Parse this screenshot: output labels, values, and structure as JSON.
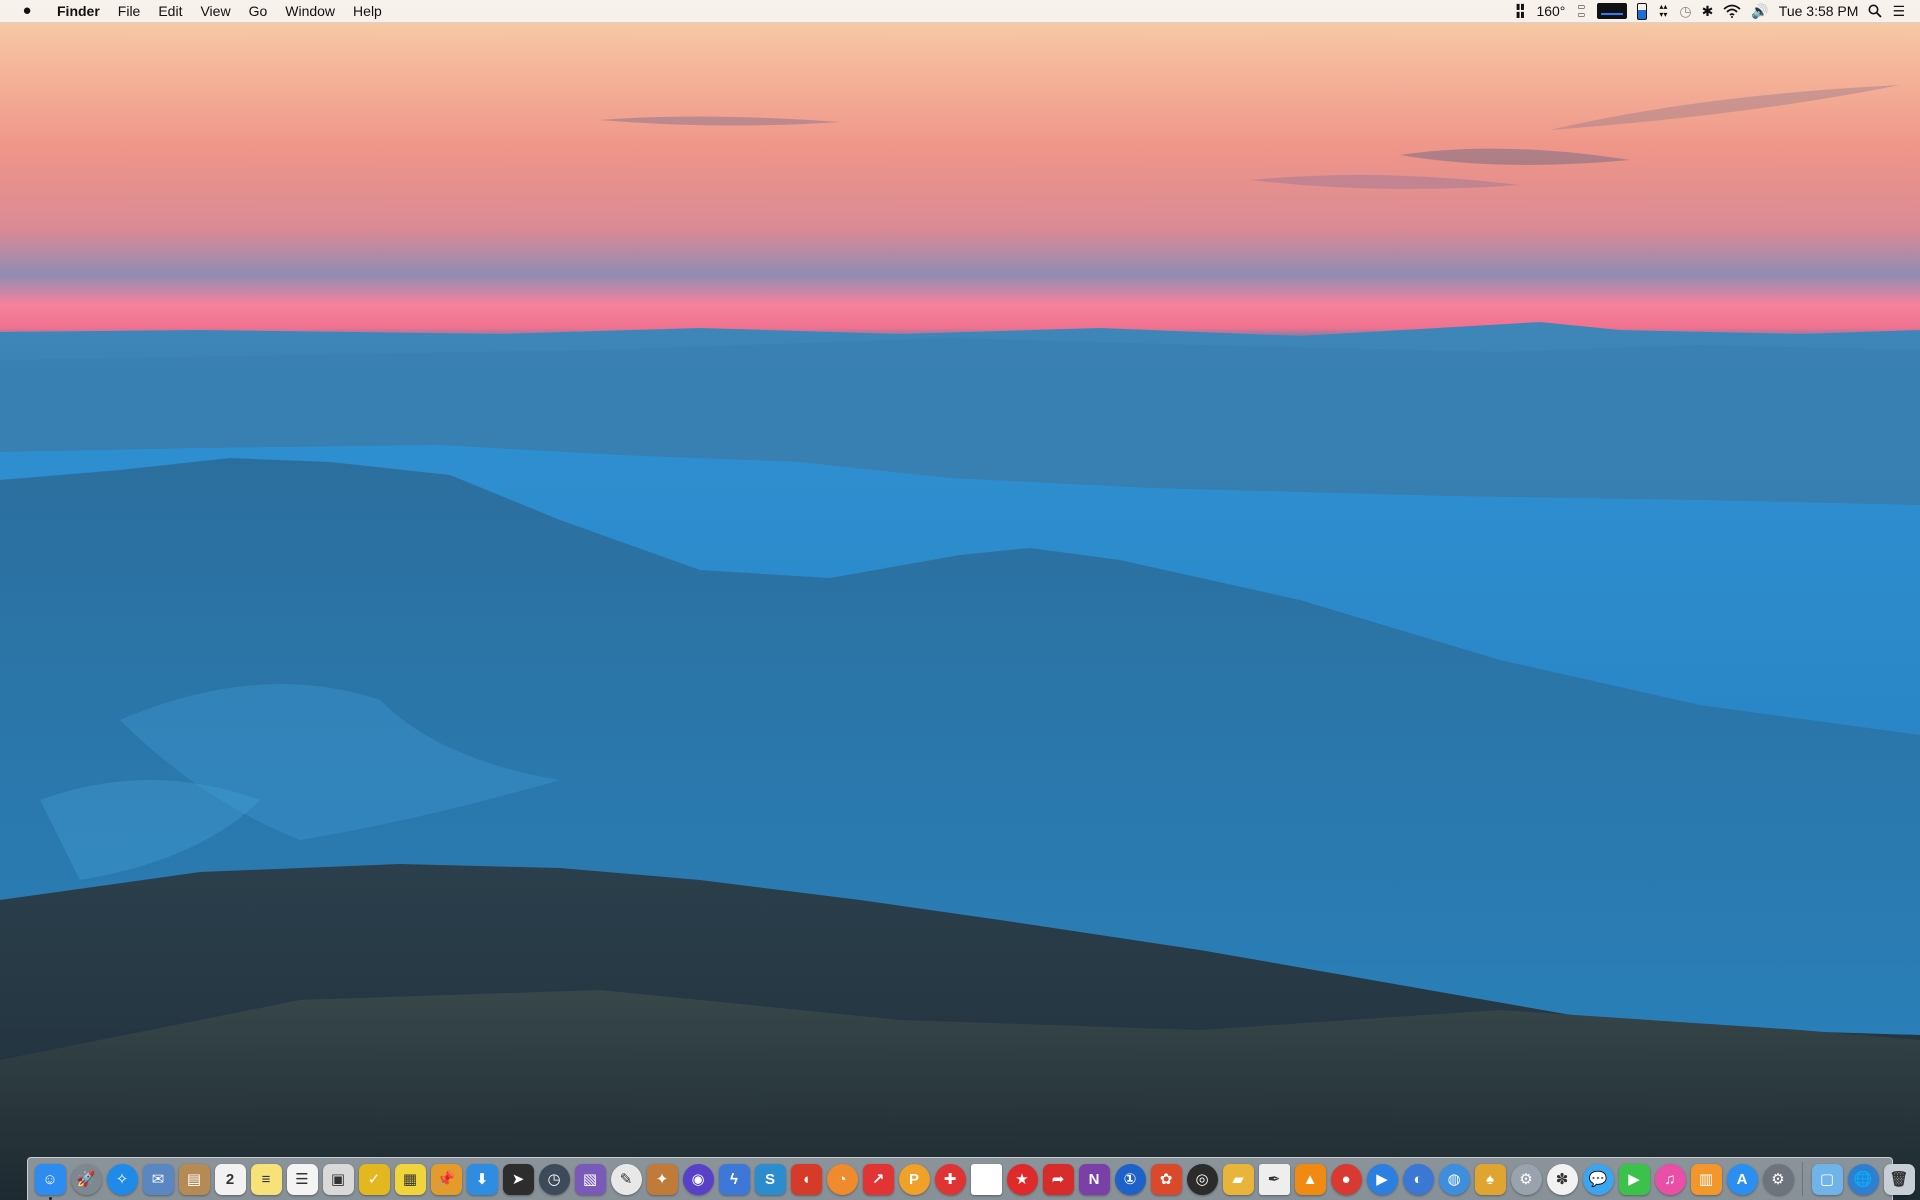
{
  "menubar": {
    "app_name": "Finder",
    "menus": [
      "File",
      "Edit",
      "View",
      "Go",
      "Window",
      "Help"
    ],
    "status": {
      "temperature": "160°",
      "clock": "Tue 3:58 PM"
    }
  },
  "dock": {
    "apps": [
      {
        "name": "finder-icon",
        "glyph": "☺",
        "color": "#2d8cf0",
        "shape": "",
        "running": true
      },
      {
        "name": "launchpad-icon",
        "glyph": "🚀",
        "color": "#7f8791",
        "shape": "round",
        "running": false
      },
      {
        "name": "safari-icon",
        "glyph": "✧",
        "color": "#1f8ae8",
        "shape": "round",
        "running": false
      },
      {
        "name": "mail-icon",
        "glyph": "✉",
        "color": "#5a86c2",
        "shape": "",
        "running": false
      },
      {
        "name": "contacts-icon",
        "glyph": "▤",
        "color": "#b58a55",
        "shape": "",
        "running": false
      },
      {
        "name": "calendar-icon",
        "glyph": "2",
        "color": "#f2f2f2",
        "shape": "",
        "running": false
      },
      {
        "name": "notes-icon",
        "glyph": "≡",
        "color": "#f7e27a",
        "shape": "",
        "running": false
      },
      {
        "name": "reminders-icon",
        "glyph": "☰",
        "color": "#f4f4f4",
        "shape": "",
        "running": false
      },
      {
        "name": "preview-icon",
        "glyph": "▣",
        "color": "#d9d9d9",
        "shape": "",
        "running": false
      },
      {
        "name": "omnifocus-icon",
        "glyph": "✓",
        "color": "#e2b720",
        "shape": "",
        "running": false
      },
      {
        "name": "stickies-icon",
        "glyph": "▦",
        "color": "#f1d43c",
        "shape": "",
        "running": false
      },
      {
        "name": "pin-icon",
        "glyph": "📌",
        "color": "#e39b2c",
        "shape": "",
        "running": false
      },
      {
        "name": "downloads-icon",
        "glyph": "⬇",
        "color": "#2e8de0",
        "shape": "",
        "running": false
      },
      {
        "name": "cursor-icon",
        "glyph": "➤",
        "color": "#2d2d2d",
        "shape": "",
        "running": false
      },
      {
        "name": "time-machine-icon",
        "glyph": "◷",
        "color": "#3c4a5a",
        "shape": "round",
        "running": false
      },
      {
        "name": "photo-browser-icon",
        "glyph": "▧",
        "color": "#7a5ab8",
        "shape": "",
        "running": false
      },
      {
        "name": "script-editor-icon",
        "glyph": "✎",
        "color": "#e8e8e8",
        "shape": "round",
        "running": false
      },
      {
        "name": "stocks-icon",
        "glyph": "✦",
        "color": "#c07a3a",
        "shape": "",
        "running": false
      },
      {
        "name": "globe-purple-icon",
        "glyph": "◉",
        "color": "#5840c9",
        "shape": "round",
        "running": false
      },
      {
        "name": "lightning-icon",
        "glyph": "ϟ",
        "color": "#3d78d8",
        "shape": "",
        "running": false
      },
      {
        "name": "scrivener-icon",
        "glyph": "S",
        "color": "#2d8ccd",
        "shape": "",
        "running": false
      },
      {
        "name": "airship-icon",
        "glyph": "◖",
        "color": "#d63b2a",
        "shape": "",
        "running": false
      },
      {
        "name": "istat-icon",
        "glyph": "◔",
        "color": "#f08a2d",
        "shape": "round",
        "running": false
      },
      {
        "name": "pushpin-red-icon",
        "glyph": "↗",
        "color": "#e23434",
        "shape": "",
        "running": false
      },
      {
        "name": "pdf-pen-icon",
        "glyph": "P",
        "color": "#f0a12a",
        "shape": "round",
        "running": false
      },
      {
        "name": "lifesaver-icon",
        "glyph": "✚",
        "color": "#e03333",
        "shape": "round",
        "running": false
      },
      {
        "name": "blank-document-icon",
        "glyph": "",
        "color": "#ffffff",
        "shape": "doc",
        "running": false
      },
      {
        "name": "red-star-icon",
        "glyph": "★",
        "color": "#e02a2a",
        "shape": "round",
        "running": false
      },
      {
        "name": "flag-icon",
        "glyph": "➦",
        "color": "#d82c2c",
        "shape": "",
        "running": false
      },
      {
        "name": "onenote-icon",
        "glyph": "N",
        "color": "#7b3fa8",
        "shape": "",
        "running": false
      },
      {
        "name": "1password-icon",
        "glyph": "①",
        "color": "#1d62c9",
        "shape": "round",
        "running": false
      },
      {
        "name": "pinwheel-icon",
        "glyph": "✿",
        "color": "#d9492a",
        "shape": "",
        "running": false
      },
      {
        "name": "dvd-player-icon",
        "glyph": "◎",
        "color": "#2b2b2b",
        "shape": "round",
        "running": false
      },
      {
        "name": "folder-yellow-icon",
        "glyph": "▰",
        "color": "#e8b53a",
        "shape": "",
        "running": false
      },
      {
        "name": "pen-editor-icon",
        "glyph": "✒",
        "color": "#eeeeee",
        "shape": "doc",
        "running": false
      },
      {
        "name": "vlc-icon",
        "glyph": "▲",
        "color": "#f08a12",
        "shape": "",
        "running": false
      },
      {
        "name": "record-icon",
        "glyph": "●",
        "color": "#d83a32",
        "shape": "round",
        "running": false
      },
      {
        "name": "quicktime-icon",
        "glyph": "▶",
        "color": "#2a7fe0",
        "shape": "round",
        "running": false
      },
      {
        "name": "blue-circle-icon",
        "glyph": "◐",
        "color": "#3b77d4",
        "shape": "round",
        "running": false
      },
      {
        "name": "chrome-icon",
        "glyph": "◍",
        "color": "#3f8ede",
        "shape": "round",
        "running": false
      },
      {
        "name": "bitcoin-owl-icon",
        "glyph": "♠",
        "color": "#e0a530",
        "shape": "",
        "running": false
      },
      {
        "name": "gears-icon",
        "glyph": "⚙",
        "color": "#9aa3ad",
        "shape": "round",
        "running": false
      },
      {
        "name": "photos-icon",
        "glyph": "✽",
        "color": "#f2f2f2",
        "shape": "round",
        "running": false
      },
      {
        "name": "messages-icon",
        "glyph": "💬",
        "color": "#3ca5f0",
        "shape": "round",
        "running": false
      },
      {
        "name": "facetime-icon",
        "glyph": "▶",
        "color": "#3cc24a",
        "shape": "",
        "running": false
      },
      {
        "name": "itunes-icon",
        "glyph": "♫",
        "color": "#e94fa6",
        "shape": "round",
        "running": false
      },
      {
        "name": "ibooks-icon",
        "glyph": "▥",
        "color": "#f3962b",
        "shape": "",
        "running": false
      },
      {
        "name": "app-store-icon",
        "glyph": "A",
        "color": "#2a8ff0",
        "shape": "round",
        "running": false
      },
      {
        "name": "system-preferences-icon",
        "glyph": "⚙",
        "color": "#6d747d",
        "shape": "round",
        "running": false
      }
    ],
    "stack_items": [
      {
        "name": "screenshot-folder-icon",
        "glyph": "▢",
        "color": "#6fb3e8",
        "shape": ""
      },
      {
        "name": "globe-folder-icon",
        "glyph": "🌐",
        "color": "#2f7fd0",
        "shape": "round"
      },
      {
        "name": "trash-icon",
        "glyph": "🗑",
        "color": "#c8ced6",
        "shape": ""
      }
    ]
  }
}
